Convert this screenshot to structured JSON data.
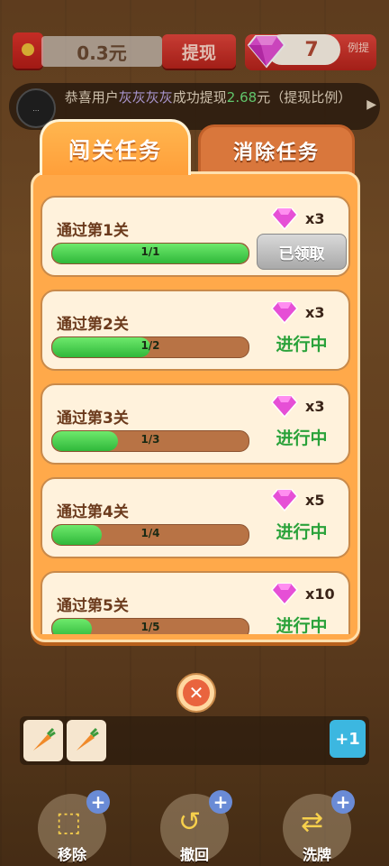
{
  "header": {
    "cash_value": "0.3元",
    "withdraw_label": "提现",
    "ratio_label": "例提",
    "gem_count": "7"
  },
  "notice": {
    "avatar_text": "...",
    "prefix": "恭喜用户",
    "username": "灰灰灰灰",
    "middle": "成功提现",
    "amount": "2.68",
    "suffix": "元（提现比例",
    "tail": "）"
  },
  "dialog": {
    "tabs": [
      {
        "label": "闯关任务",
        "active": true
      },
      {
        "label": "消除任务",
        "active": false
      }
    ],
    "tasks": [
      {
        "name": "通过第1关",
        "progress_text": "1/1",
        "progress": 1.0,
        "reward": "x3",
        "action": "已领取"
      },
      {
        "name": "通过第2关",
        "progress_text": "1/2",
        "progress": 0.5,
        "reward": "x3",
        "action": "进行中"
      },
      {
        "name": "通过第3关",
        "progress_text": "1/3",
        "progress": 0.333,
        "reward": "x3",
        "action": "进行中"
      },
      {
        "name": "通过第4关",
        "progress_text": "1/4",
        "progress": 0.25,
        "reward": "x5",
        "action": "进行中"
      },
      {
        "name": "通过第5关",
        "progress_text": "1/5",
        "progress": 0.2,
        "reward": "x10",
        "action": "进行中"
      }
    ],
    "close_icon": "close-icon"
  },
  "tray": {
    "plus_label": "+1"
  },
  "tools": [
    {
      "label": "移除",
      "icon": "remove-icon"
    },
    {
      "label": "撤回",
      "icon": "undo-icon"
    },
    {
      "label": "洗牌",
      "icon": "shuffle-icon"
    }
  ],
  "colors": {
    "accent_orange": "#ffa94a",
    "progress_green": "#2fb83a",
    "status_green": "#2aa23a",
    "gem_pink": "#e056d8"
  }
}
